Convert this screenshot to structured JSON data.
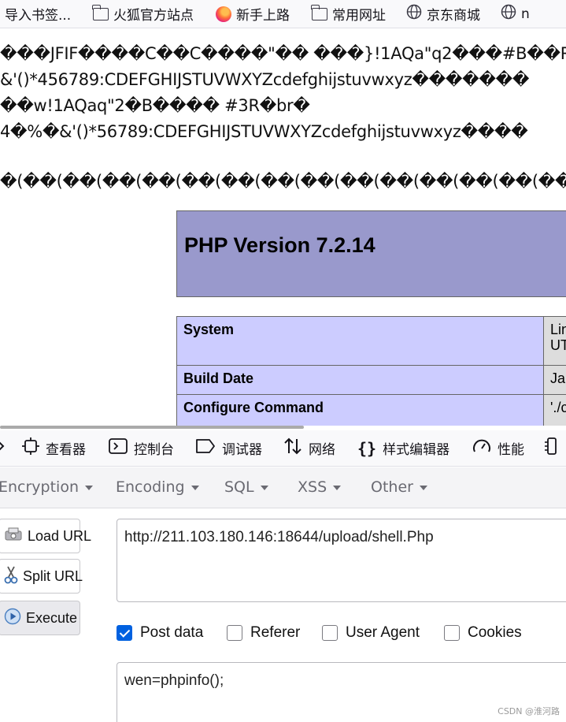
{
  "bookmarks": [
    {
      "label": "导入书签...",
      "icon": "import-icon"
    },
    {
      "label": "火狐官方站点",
      "icon": "folder-icon"
    },
    {
      "label": "新手上路",
      "icon": "firefox-icon"
    },
    {
      "label": "常用网址",
      "icon": "folder-icon"
    },
    {
      "label": "京东商城",
      "icon": "globe-icon"
    },
    {
      "label": "n",
      "icon": "globe-icon"
    }
  ],
  "page": {
    "garbled_lines": [
      "���JFIF����C��C����\"�� ���}!1AQa\"q2���#B��R",
      "&'()*456789:CDEFGHIJSTUVWXYZcdefghijstuvwxyz�������",
      "��w!1AQaq\"2�B���� #3R�br�",
      "4�%�&'()*56789:CDEFGHIJSTUVWXYZcdefghijstuvwxyz����",
      "�(��(��(��(��(��(��(��(��(��(��(��(��(��(��("
    ],
    "php_title": "PHP Version 7.2.14",
    "info_rows": [
      {
        "key": "System",
        "value": "Lin\nUT"
      },
      {
        "key": "Build Date",
        "value": "Jar"
      },
      {
        "key": "Configure Command",
        "value": "'./c"
      }
    ]
  },
  "devtools": {
    "tabs": [
      {
        "label": "",
        "icon": "pointer-icon"
      },
      {
        "label": "查看器",
        "icon": "inspector-icon"
      },
      {
        "label": "控制台",
        "icon": "console-icon"
      },
      {
        "label": "调试器",
        "icon": "debugger-icon"
      },
      {
        "label": "网络",
        "icon": "network-icon"
      },
      {
        "label": "样式编辑器",
        "icon": "style-editor-icon"
      },
      {
        "label": "性能",
        "icon": "performance-icon"
      },
      {
        "label": "",
        "icon": "memory-icon"
      }
    ]
  },
  "hackbar": {
    "menus": [
      "Encryption",
      "Encoding",
      "SQL",
      "XSS",
      "Other"
    ],
    "buttons": {
      "load": "Load URL",
      "split": "Split URL",
      "execute": "Execute"
    },
    "url_value": "http://211.103.180.146:18644/upload/shell.Php",
    "options": [
      {
        "label": "Post data",
        "checked": true
      },
      {
        "label": "Referer",
        "checked": false
      },
      {
        "label": "User Agent",
        "checked": false
      },
      {
        "label": "Cookies",
        "checked": false
      }
    ],
    "post_value": "wen=phpinfo();"
  },
  "watermark": "CSDN @淮河路"
}
